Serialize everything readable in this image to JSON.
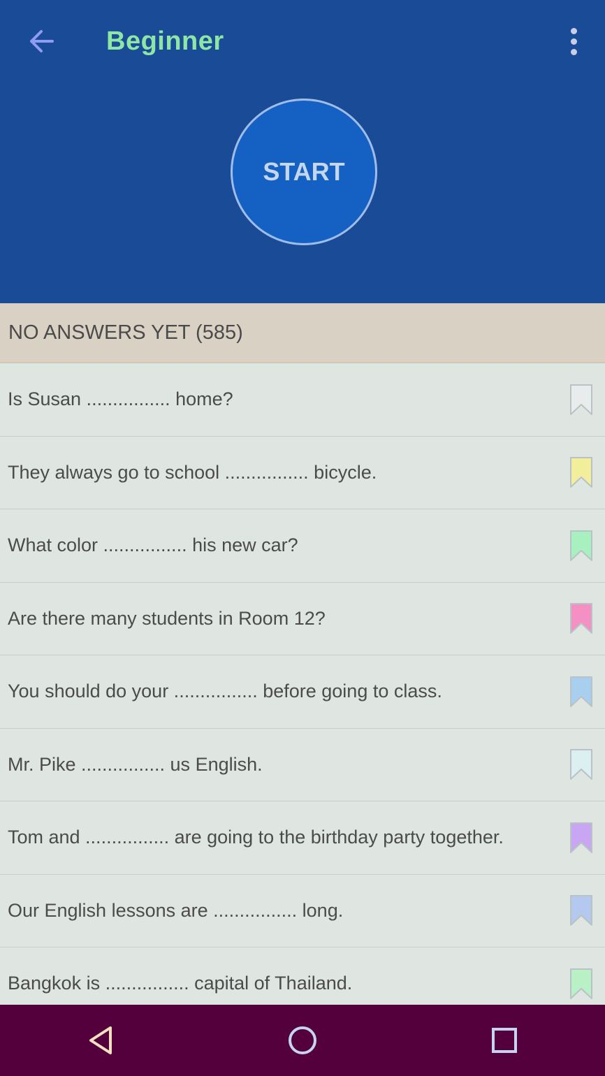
{
  "header": {
    "title": "Beginner",
    "start_label": "START",
    "background": "#1a4b96"
  },
  "section": {
    "label": "NO ANSWERS YET (585)"
  },
  "questions": [
    {
      "text": "Is Susan ................ home?",
      "bookmark_color": "#e8ecec"
    },
    {
      "text": "They always go to school ................ bicycle.",
      "bookmark_color": "#f3ee9c"
    },
    {
      "text": "What color ................ his new car?",
      "bookmark_color": "#a8f0c0"
    },
    {
      "text": "Are there many students in Room 12?",
      "bookmark_color": "#f590c4"
    },
    {
      "text": "You should do your ................ before going to class.",
      "bookmark_color": "#a8cff0"
    },
    {
      "text": "Mr. Pike ................ us English.",
      "bookmark_color": "#dceff3"
    },
    {
      "text": "Tom and ................ are going to the birthday party together.",
      "bookmark_color": "#c9a6f3"
    },
    {
      "text": "Our English lessons are ................ long.",
      "bookmark_color": "#b3c9ee"
    },
    {
      "text": "Bangkok is ................ capital of Thailand.",
      "bookmark_color": "#b9f0c6"
    }
  ],
  "icons": {
    "back": "arrow-left-icon",
    "menu": "more-vert-icon",
    "bookmark": "bookmark-icon",
    "nav_back": "triangle-back-icon",
    "nav_home": "circle-home-icon",
    "nav_recents": "square-recents-icon"
  },
  "colors": {
    "title": "#8ee6a6",
    "start_circle": "#1560c3",
    "section_header": "#d9d2c4",
    "list_bg": "#dfe6e1",
    "nav_bar": "#54003c"
  }
}
